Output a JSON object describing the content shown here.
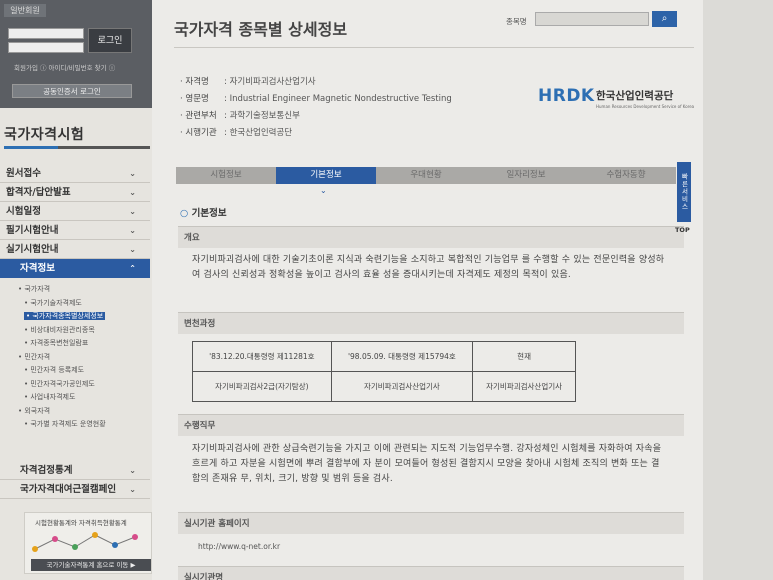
{
  "login": {
    "tab": "일반회원",
    "button": "로그인",
    "links": "회원가입 ⓘ  아이디/비밀번호 찾기 ⓘ",
    "cert_button": "공동인증서 로그인"
  },
  "sidebar": {
    "title": "국가자격시험",
    "menu": [
      {
        "label": "원서접수"
      },
      {
        "label": "합격자/답안발표"
      },
      {
        "label": "시험일정"
      },
      {
        "label": "필기시험안내"
      },
      {
        "label": "실기시험안내"
      },
      {
        "label": "자격정보"
      }
    ],
    "sub": [
      {
        "label": "• 국가자격"
      },
      {
        "label": "• 국가기술자격제도"
      },
      {
        "label": "• 국가자격종목별상세정보"
      },
      {
        "label": "• 비상대비자원관리종목"
      },
      {
        "label": "• 자격종목변천일람표"
      },
      {
        "label": "• 민간자격"
      },
      {
        "label": "• 민간자격 등록제도"
      },
      {
        "label": "• 민간자격국가공인제도"
      },
      {
        "label": "• 사업내자격제도"
      },
      {
        "label": "• 외국자격"
      },
      {
        "label": "• 국가별 자격제도 운영현황"
      }
    ],
    "bottom": [
      {
        "label": "자격검정통계"
      },
      {
        "label": "국가자격대여근절캠페인"
      }
    ],
    "stats_title": "시험현황통계와 자격취득현황통계",
    "stats_button": "국가기술자격통계 홈으로 이동 ▶"
  },
  "header": {
    "title": "국가자격 종목별 상세정보",
    "search_label": "종목명",
    "search_value": ""
  },
  "info": [
    {
      "label": "· 자격명",
      "value": ": 자기비파괴검사산업기사"
    },
    {
      "label": "· 영문명",
      "value": ": Industrial Engineer Magnetic Nondestructive Testing"
    },
    {
      "label": "· 관련부처",
      "value": ": 과학기술정보통신부"
    },
    {
      "label": "· 시행기관",
      "value": ": 한국산업인력공단"
    }
  ],
  "logo": {
    "mark": "HRDK",
    "name": "한국산업인력공단",
    "sub": "Human Resources Development Service of Korea"
  },
  "tabs": [
    {
      "label": "시험정보"
    },
    {
      "label": "기본정보"
    },
    {
      "label": "우대현황"
    },
    {
      "label": "일자리정보"
    },
    {
      "label": "수험자동향"
    }
  ],
  "section": {
    "title": "기본정보"
  },
  "overview": {
    "heading": "개요",
    "text": "자기비파괴검사에 대한 기술기초이론 지식과 숙련기능을 소지하고 복합적인 기능업무 를 수행할 수 있는 전문인력을 양성하여 검사의 신뢰성과 정확성을 높이고 검사의 효율 성을 증대시키는데 자격제도 제정의 목적이 있음."
  },
  "history": {
    "heading": "변천과정",
    "rows": [
      [
        "'83.12.20.대통령령 제11281호",
        "'98.05.09. 대통령령 제15794호",
        "현재"
      ],
      [
        "자기비파괴검사2급(자기탐상)",
        "자기비파괴검사산업기사",
        "자기비파괴검사산업기사"
      ]
    ]
  },
  "duties": {
    "heading": "수행직무",
    "text": "자기비파괴검사에 관한 상급숙련기능을 가지고 이에 관련되는 지도적 기능업무수행. 강자성체인 시험체를 자화하여 자속을 흐르게 하고 자분을 시험면에 뿌려 결함부에 자 분이 모여들어 형성된 결함지시 모양을 찾아내 시험체 조직의 변화 또는 결함의 존재유 무, 위치, 크기, 방향 및 범위 등을 검사."
  },
  "homepage": {
    "heading": "실시기관 홈페이지",
    "url": "http://www.q-net.or.kr"
  },
  "next_section": {
    "heading": "실시기관명"
  },
  "quick": {
    "label": "빠른서비스",
    "top": "TOP"
  }
}
